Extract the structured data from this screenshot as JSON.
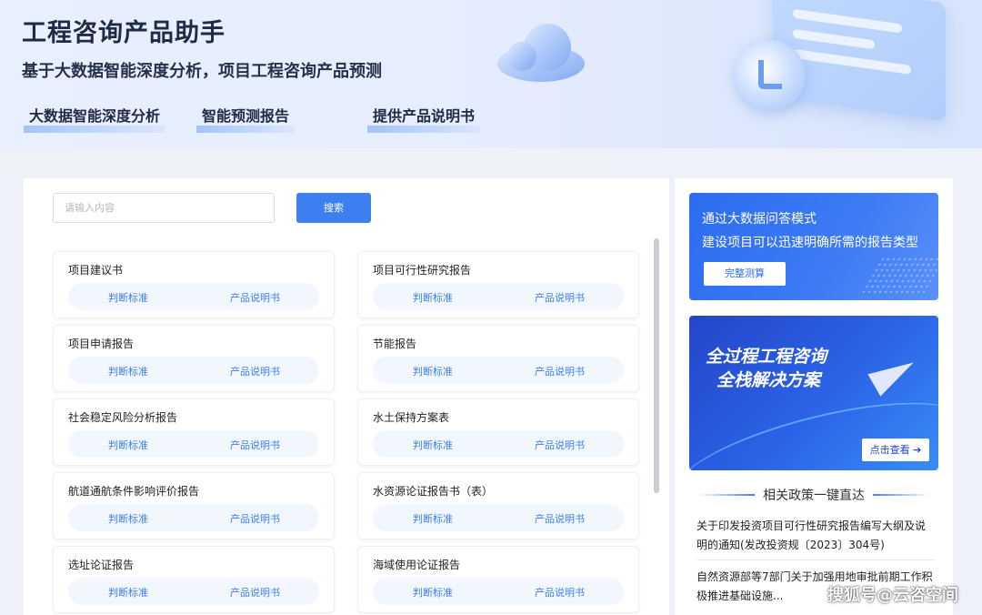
{
  "banner": {
    "title": "工程咨询产品助手",
    "subtitle": "基于大数据智能深度分析，项目工程咨询产品预测",
    "features": [
      "大数据智能深度分析",
      "智能预测报告",
      "提供产品说明书"
    ]
  },
  "search": {
    "placeholder": "请输入内容",
    "button_label": "搜索"
  },
  "cards": [
    {
      "title": "项目建议书",
      "link1": "判断标准",
      "link2": "产品说明书"
    },
    {
      "title": "项目可行性研究报告",
      "link1": "判断标准",
      "link2": "产品说明书"
    },
    {
      "title": "项目申请报告",
      "link1": "判断标准",
      "link2": "产品说明书"
    },
    {
      "title": "节能报告",
      "link1": "判断标准",
      "link2": "产品说明书"
    },
    {
      "title": "社会稳定风险分析报告",
      "link1": "判断标准",
      "link2": "产品说明书"
    },
    {
      "title": "水土保持方案表",
      "link1": "判断标准",
      "link2": "产品说明书"
    },
    {
      "title": "航道通航条件影响评价报告",
      "link1": "判断标准",
      "link2": "产品说明书"
    },
    {
      "title": "水资源论证报告书（表）",
      "link1": "判断标准",
      "link2": "产品说明书"
    },
    {
      "title": "选址论证报告",
      "link1": "判断标准",
      "link2": "产品说明书"
    },
    {
      "title": "海域使用论证报告",
      "link1": "判断标准",
      "link2": "产品说明书"
    }
  ],
  "promo1": {
    "line1": "通过大数据问答模式",
    "line2": "建设项目可以迅速明确所需的报告类型",
    "button": "完整测算"
  },
  "promo2": {
    "line1": "全过程工程咨询",
    "line2": "全栈解决方案",
    "button": "点击查看 ➔"
  },
  "policy": {
    "heading": "相关政策一键直达",
    "items": [
      "关于印发投资项目可行性研究报告编写大纲及说明的通知(发改投资规〔2023〕304号)",
      "自然资源部等7部门关于加强用地审批前期工作积极推进基础设施..."
    ]
  },
  "watermark": "搜狐号@云咨空间",
  "colors": {
    "accent": "#3e7ff0",
    "banner_bg": "#e6edfd",
    "page_bg": "#eef1f7"
  }
}
